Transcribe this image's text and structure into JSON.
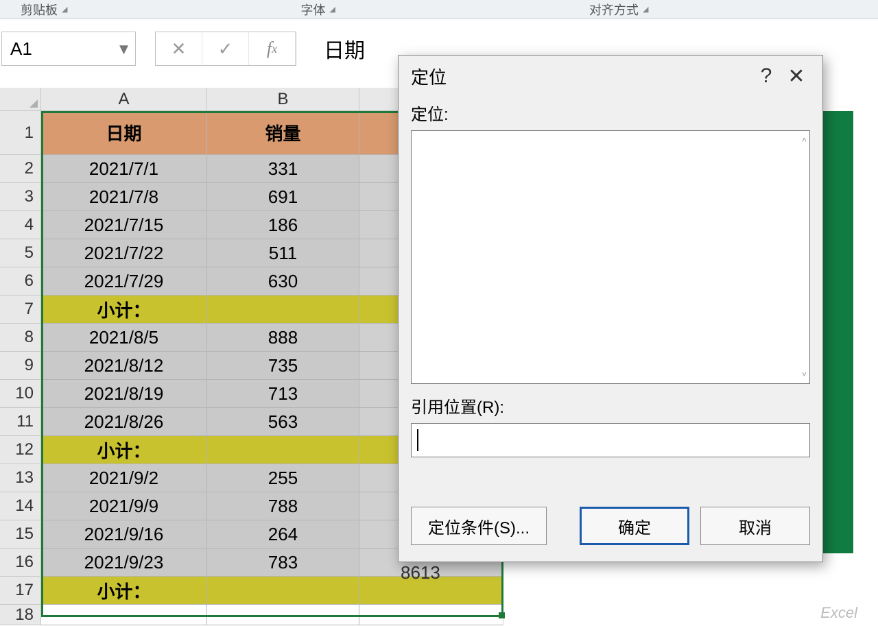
{
  "ribbon": {
    "clipboard": "剪贴板",
    "font": "字体",
    "align": "对齐方式"
  },
  "namebox": "A1",
  "formula_value": "日期",
  "columns": [
    "A",
    "B"
  ],
  "headers": {
    "date": "日期",
    "sales": "销量"
  },
  "subtotal_label": "小计：",
  "rows": [
    {
      "n": 1,
      "type": "header"
    },
    {
      "n": 2,
      "type": "data",
      "a": "2021/7/1",
      "b": "331"
    },
    {
      "n": 3,
      "type": "data",
      "a": "2021/7/8",
      "b": "691"
    },
    {
      "n": 4,
      "type": "data",
      "a": "2021/7/15",
      "b": "186"
    },
    {
      "n": 5,
      "type": "data",
      "a": "2021/7/22",
      "b": "511"
    },
    {
      "n": 6,
      "type": "data",
      "a": "2021/7/29",
      "b": "630"
    },
    {
      "n": 7,
      "type": "sub"
    },
    {
      "n": 8,
      "type": "data",
      "a": "2021/8/5",
      "b": "888"
    },
    {
      "n": 9,
      "type": "data",
      "a": "2021/8/12",
      "b": "735"
    },
    {
      "n": 10,
      "type": "data",
      "a": "2021/8/19",
      "b": "713"
    },
    {
      "n": 11,
      "type": "data",
      "a": "2021/8/26",
      "b": "563"
    },
    {
      "n": 12,
      "type": "sub"
    },
    {
      "n": 13,
      "type": "data",
      "a": "2021/9/2",
      "b": "255"
    },
    {
      "n": 14,
      "type": "data",
      "a": "2021/9/9",
      "b": "788"
    },
    {
      "n": 15,
      "type": "data",
      "a": "2021/9/16",
      "b": "264"
    },
    {
      "n": 16,
      "type": "data",
      "a": "2021/9/23",
      "b": "783"
    },
    {
      "n": 17,
      "type": "sub"
    },
    {
      "n": 18,
      "type": "blank"
    }
  ],
  "peek_value": "8613",
  "dialog": {
    "title": "定位",
    "goto_label": "定位:",
    "reference_label": "引用位置(R):",
    "reference_value": "",
    "btn_special": "定位条件(S)...",
    "btn_ok": "确定",
    "btn_cancel": "取消"
  },
  "watermark": "Excel"
}
